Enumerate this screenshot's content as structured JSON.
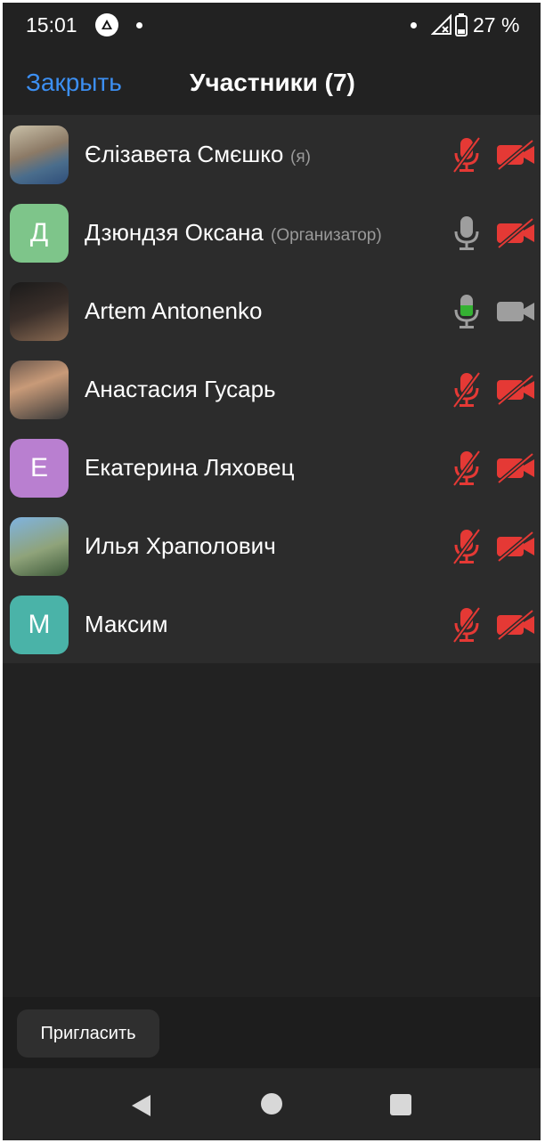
{
  "status_bar": {
    "time": "15:01",
    "battery": "27 %"
  },
  "header": {
    "close_label": "Закрыть",
    "title": "Участники (7)"
  },
  "colors": {
    "accent": "#3c8ff2",
    "muted_red": "#e53935",
    "speaking_green": "#35b233",
    "mic_gray": "#9e9e9e"
  },
  "participants": [
    {
      "name": "Єлізавета Смєшко",
      "role": "(я)",
      "avatar": "photo",
      "mic": "muted",
      "video": "off"
    },
    {
      "name": "Дзюндзя Оксана",
      "role": "(Организатор)",
      "avatar_letter": "Д",
      "avatar_color": "#7ec58a",
      "mic": "on",
      "video": "off"
    },
    {
      "name": "Artem Antonenko",
      "role": "",
      "avatar": "photo",
      "mic": "speaking",
      "video": "on"
    },
    {
      "name": "Анастасия Гусарь",
      "role": "",
      "avatar": "photo",
      "mic": "muted",
      "video": "off"
    },
    {
      "name": "Екатерина Ляховец",
      "role": "",
      "avatar_letter": "Е",
      "avatar_color": "#b97fd0",
      "mic": "muted",
      "video": "off"
    },
    {
      "name": "Илья Храполович",
      "role": "",
      "avatar": "photo",
      "mic": "muted",
      "video": "off"
    },
    {
      "name": "Максим",
      "role": "",
      "avatar_letter": "М",
      "avatar_color": "#4ab3a8",
      "mic": "muted",
      "video": "off"
    }
  ],
  "footer": {
    "invite_label": "Пригласить"
  },
  "icons": [
    "app-notification-icon",
    "signal-icon",
    "battery-icon",
    "mic-muted-icon",
    "mic-icon",
    "video-off-icon",
    "video-icon",
    "back-icon",
    "home-icon",
    "recents-icon"
  ]
}
